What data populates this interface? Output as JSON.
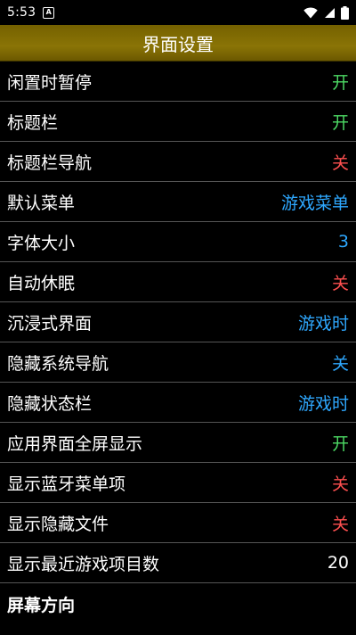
{
  "status_bar": {
    "time": "5:53",
    "notification_letter": "A"
  },
  "title_bar": {
    "title": "界面设置"
  },
  "settings": [
    {
      "label": "闲置时暂停",
      "value": "开",
      "value_color": "#4cd964"
    },
    {
      "label": "标题栏",
      "value": "开",
      "value_color": "#4cd964"
    },
    {
      "label": "标题栏导航",
      "value": "关",
      "value_color": "#ff5050"
    },
    {
      "label": "默认菜单",
      "value": "游戏菜单",
      "value_color": "#2ea8ff"
    },
    {
      "label": "字体大小",
      "value": "3",
      "value_color": "#2ea8ff"
    },
    {
      "label": "自动休眠",
      "value": "关",
      "value_color": "#ff5050"
    },
    {
      "label": "沉浸式界面",
      "value": "游戏时",
      "value_color": "#2ea8ff"
    },
    {
      "label": "隐藏系统导航",
      "value": "关",
      "value_color": "#2ea8ff"
    },
    {
      "label": "隐藏状态栏",
      "value": "游戏时",
      "value_color": "#2ea8ff"
    },
    {
      "label": "应用界面全屏显示",
      "value": "开",
      "value_color": "#4cd964"
    },
    {
      "label": "显示蓝牙菜单项",
      "value": "关",
      "value_color": "#ff5050"
    },
    {
      "label": "显示隐藏文件",
      "value": "关",
      "value_color": "#ff5050"
    },
    {
      "label": "显示最近游戏项目数",
      "value": "20",
      "value_color": "#ffffff"
    }
  ],
  "section": {
    "label": "屏幕方向"
  }
}
